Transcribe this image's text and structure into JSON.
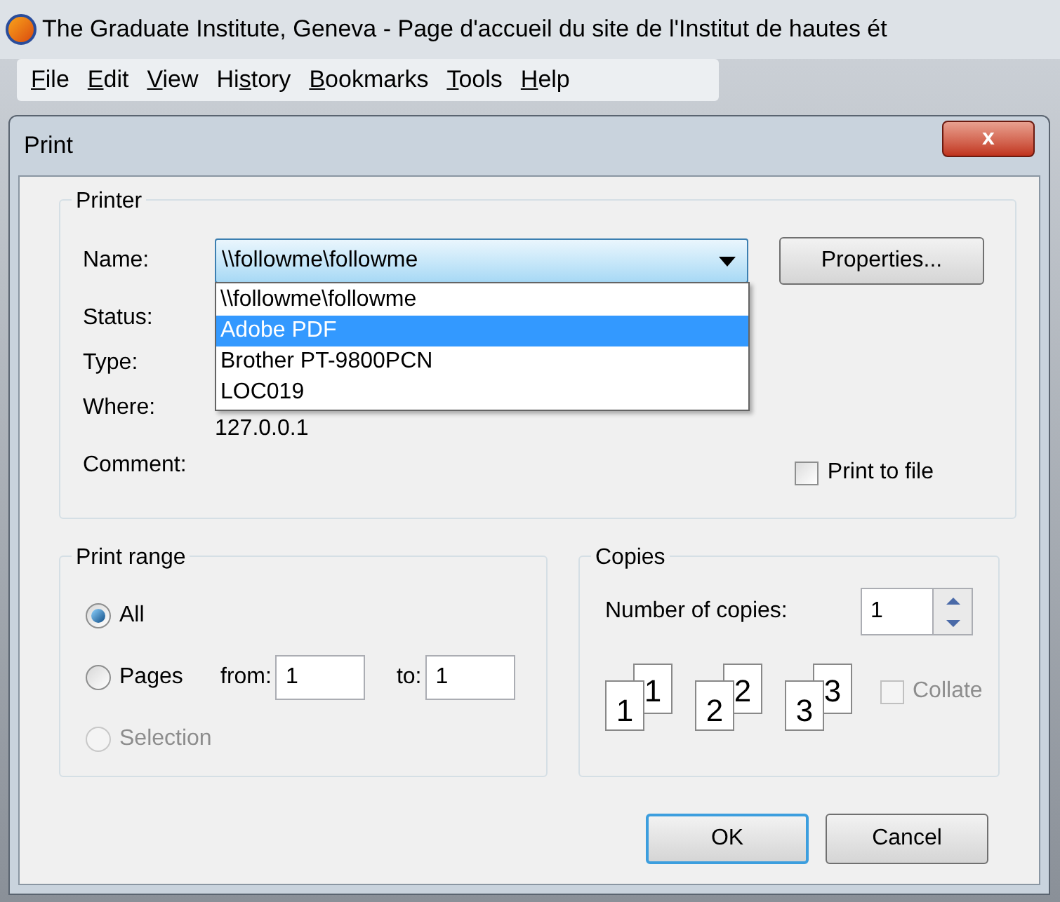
{
  "browser": {
    "title": "The Graduate Institute, Geneva - Page d'accueil du site de l'Institut de hautes ét"
  },
  "menu": [
    {
      "key": "F",
      "after": "ile"
    },
    {
      "key": "E",
      "after": "dit"
    },
    {
      "key": "V",
      "after": "iew"
    },
    {
      "before": "Hi",
      "key": "s",
      "after": "tory"
    },
    {
      "key": "B",
      "after": "ookmarks"
    },
    {
      "key": "T",
      "after": "ools"
    },
    {
      "key": "H",
      "after": "elp"
    }
  ],
  "dialog": {
    "title": "Print",
    "close": "x"
  },
  "printer": {
    "legend": "Printer",
    "name_label": "Name:",
    "name_value": "\\\\followme\\followme",
    "properties": "Properties...",
    "options": [
      {
        "label": "\\\\followme\\followme",
        "selected": false
      },
      {
        "label": "Adobe PDF",
        "selected": true
      },
      {
        "label": "Brother PT-9800PCN",
        "selected": false
      },
      {
        "label": "LOC019",
        "selected": false
      }
    ],
    "status_label": "Status:",
    "type_label": "Type:",
    "where_label": "Where:",
    "where_value": "127.0.0.1",
    "comment_label": "Comment:",
    "print_to_file": {
      "label": "Print to file",
      "checked": false
    }
  },
  "print_range": {
    "legend": "Print range",
    "options": [
      {
        "label": "All",
        "selected": true,
        "disabled": false
      },
      {
        "label": "Pages",
        "selected": false,
        "disabled": false
      },
      {
        "label": "Selection",
        "selected": false,
        "disabled": true
      }
    ],
    "from_label": "from:",
    "from_value": "1",
    "to_label": "to:",
    "to_value": "1"
  },
  "copies": {
    "legend": "Copies",
    "number_label": "Number of copies:",
    "number_value": "1",
    "collate_pages": [
      {
        "front": "1",
        "back": "1"
      },
      {
        "front": "2",
        "back": "2"
      },
      {
        "front": "3",
        "back": "3"
      }
    ],
    "collate": {
      "label": "Collate",
      "checked": false,
      "disabled": true
    }
  },
  "buttons": [
    {
      "label": "OK",
      "default": true
    },
    {
      "label": "Cancel",
      "default": false
    }
  ]
}
